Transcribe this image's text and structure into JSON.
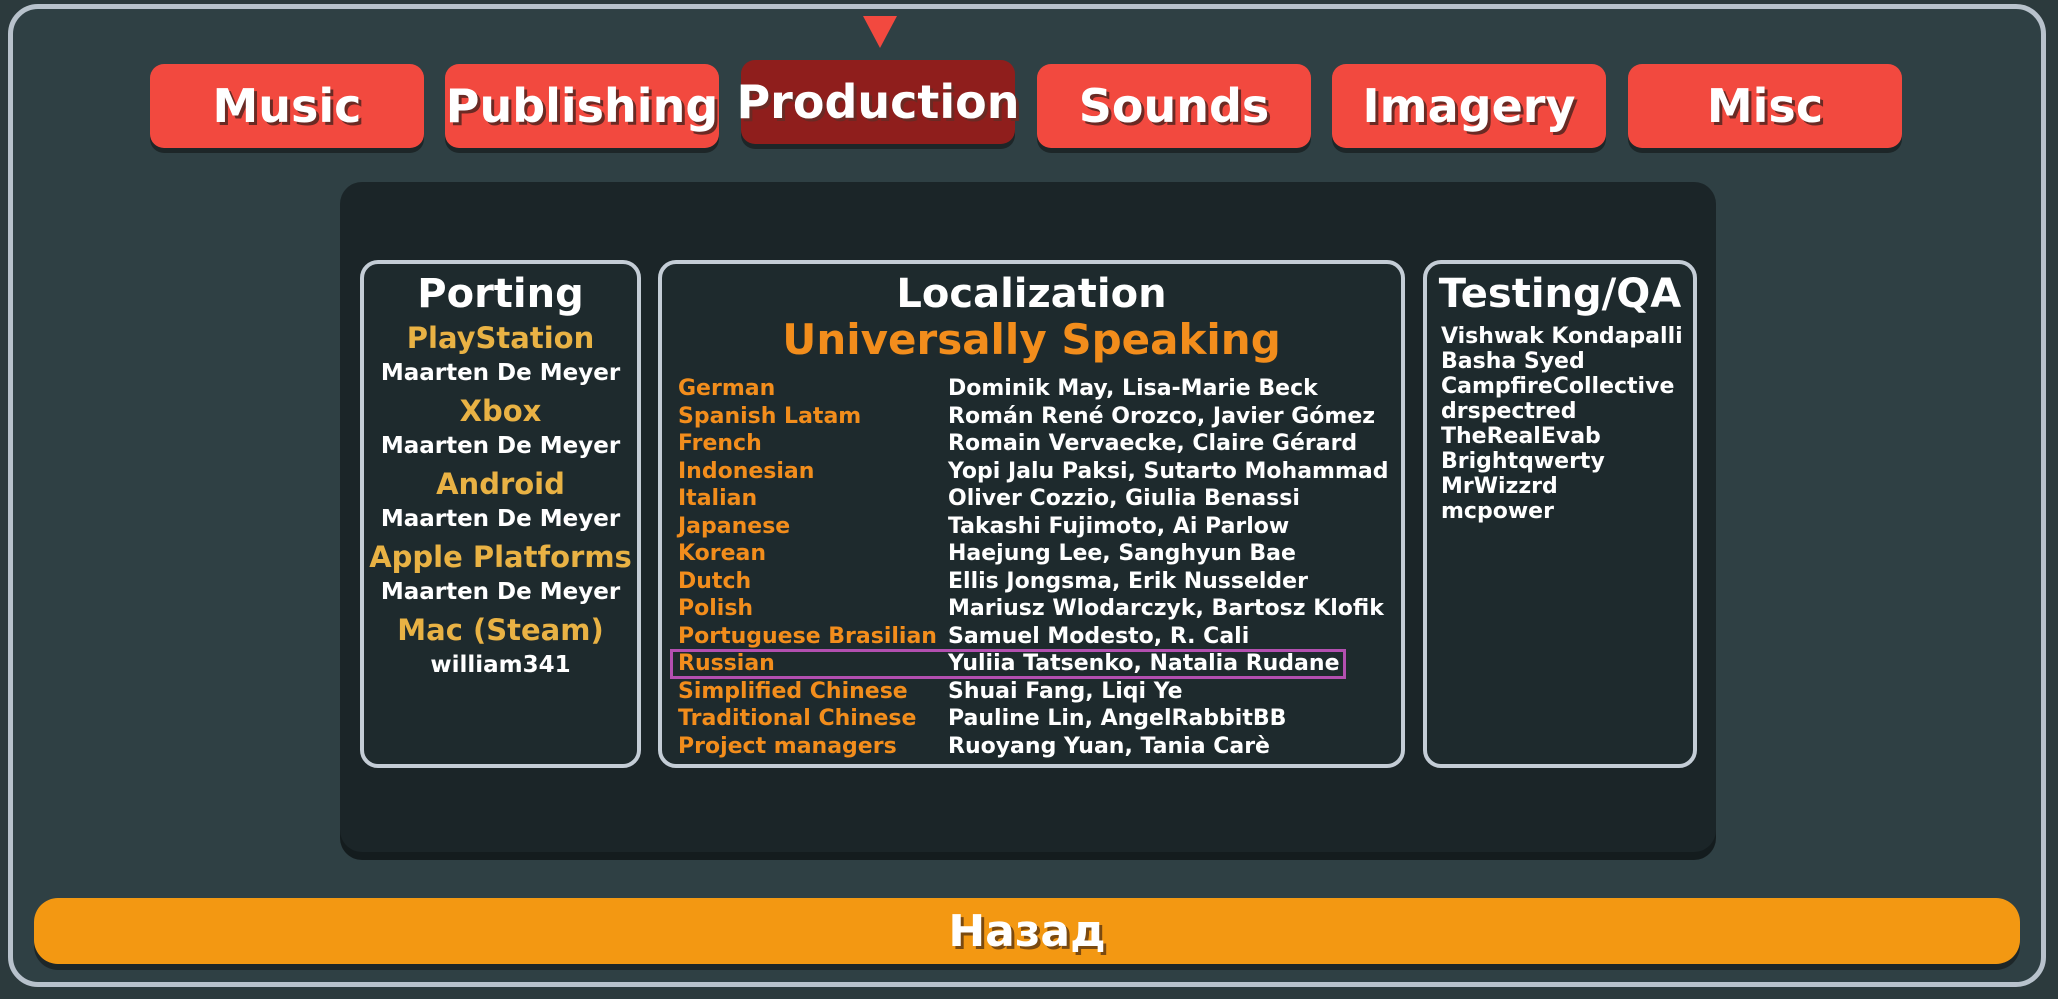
{
  "tabs": [
    {
      "label": "Music",
      "active": false
    },
    {
      "label": "Publishing",
      "active": false
    },
    {
      "label": "Production",
      "active": true
    },
    {
      "label": "Sounds",
      "active": false
    },
    {
      "label": "Imagery",
      "active": false
    },
    {
      "label": "Misc",
      "active": false
    }
  ],
  "porting": {
    "title": "Porting",
    "entries": [
      {
        "platform": "PlayStation",
        "person": "Maarten De Meyer"
      },
      {
        "platform": "Xbox",
        "person": "Maarten De Meyer"
      },
      {
        "platform": "Android",
        "person": "Maarten De Meyer"
      },
      {
        "platform": "Apple Platforms",
        "person": "Maarten De Meyer"
      },
      {
        "platform": "Mac (Steam)",
        "person": "william341"
      }
    ]
  },
  "localization": {
    "title": "Localization",
    "company": "Universally Speaking",
    "rows": [
      {
        "language": "German",
        "names": "Dominik May, Lisa-Marie Beck"
      },
      {
        "language": "Spanish Latam",
        "names": "Román René Orozco, Javier Gómez"
      },
      {
        "language": "French",
        "names": "Romain Vervaecke, Claire Gérard"
      },
      {
        "language": "Indonesian",
        "names": "Yopi Jalu Paksi, Sutarto Mohammad"
      },
      {
        "language": "Italian",
        "names": "Oliver Cozzio, Giulia Benassi"
      },
      {
        "language": "Japanese",
        "names": "Takashi Fujimoto, Ai Parlow"
      },
      {
        "language": "Korean",
        "names": "Haejung Lee, Sanghyun Bae"
      },
      {
        "language": "Dutch",
        "names": "Ellis Jongsma, Erik Nusselder"
      },
      {
        "language": "Polish",
        "names": "Mariusz Wlodarczyk, Bartosz Klofik"
      },
      {
        "language": "Portuguese Brasilian",
        "names": "Samuel Modesto, R. Cali"
      },
      {
        "language": "Russian",
        "names": "Yuliia Tatsenko, Natalia Rudane"
      },
      {
        "language": "Simplified Chinese",
        "names": "Shuai Fang, Liqi Ye"
      },
      {
        "language": "Traditional Chinese",
        "names": "Pauline Lin, AngelRabbitBB"
      },
      {
        "language": "Project managers",
        "names": "Ruoyang Yuan, Tania Carè"
      }
    ]
  },
  "qa": {
    "title": "Testing/QA",
    "testers": [
      "Vishwak Kondapalli",
      "Basha Syed",
      "CampfireCollective",
      "drspectred",
      "TheRealEvab",
      "Brightqwerty",
      "MrWizzrd",
      "mcpower"
    ]
  },
  "back_button": {
    "label": "Назад"
  },
  "colors": {
    "tab": "#f2493f",
    "tab_active": "#8f1e1c",
    "accent_orange": "#f28d1c",
    "gold": "#e9b244",
    "selection": "#b34fb0",
    "back": "#f39812"
  }
}
